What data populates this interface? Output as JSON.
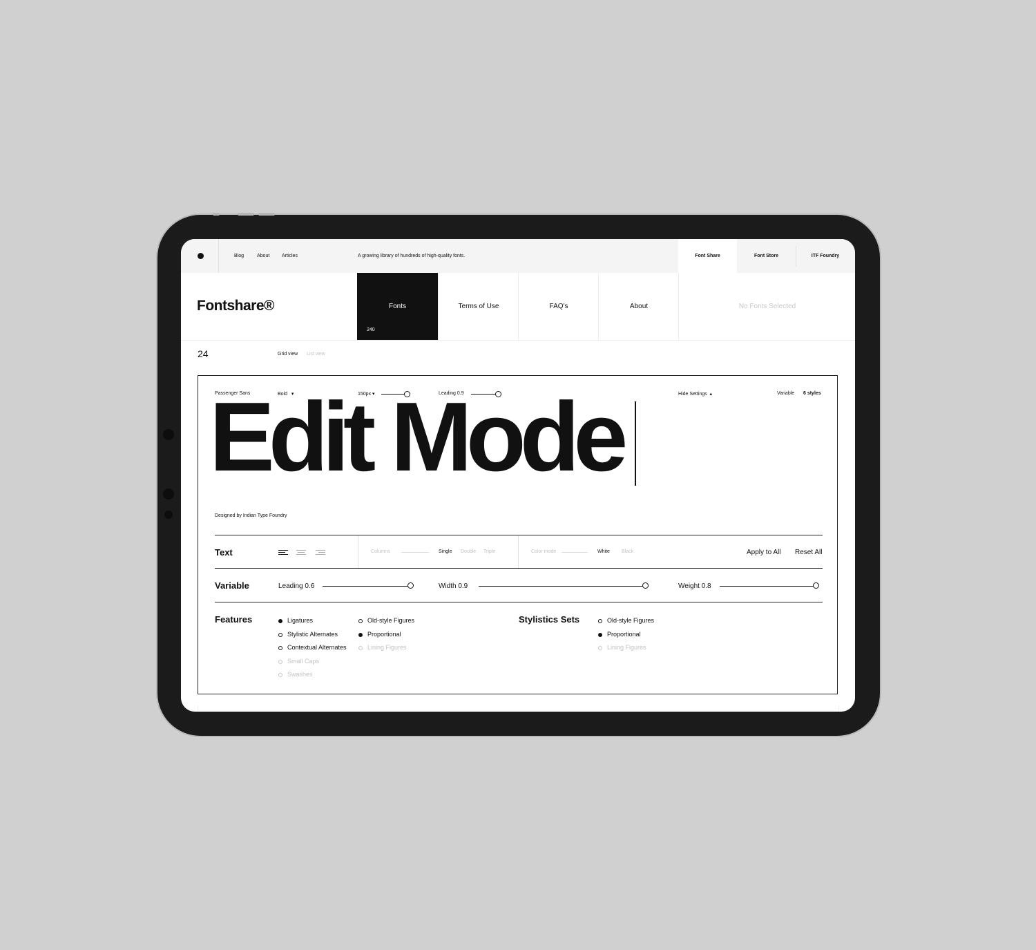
{
  "topbar": {
    "links": [
      "Blog",
      "About",
      "Articles"
    ],
    "tagline": "A growing library of hundreds of high-quality fonts.",
    "tabs": [
      "Font Share",
      "Font Store",
      "ITF Foundry"
    ]
  },
  "header": {
    "logo": "Fontshare®",
    "nav": [
      {
        "label": "Fonts",
        "count": "240"
      },
      {
        "label": "Terms of Use"
      },
      {
        "label": "FAQ's"
      },
      {
        "label": "About"
      }
    ],
    "selection": "No Fonts Selected"
  },
  "listbar": {
    "count": "24",
    "views": [
      "Grid view",
      "List view"
    ]
  },
  "card": {
    "font_name": "Passenger Sans",
    "weight": "Bold",
    "size": "150px",
    "leading_label": "Leading 0.9",
    "hide_settings": "Hide Settings",
    "variable": "Variable",
    "styles": "6 styles",
    "preview_text": "Edit Mode",
    "designer": "Designed by Indian Type Foundry"
  },
  "text_row": {
    "label": "Text",
    "columns_label": "Columns",
    "columns": [
      "Single",
      "Double",
      "Triple"
    ],
    "colormode_label": "Color mode",
    "colormodes": [
      "White",
      "Black"
    ],
    "apply_all": "Apply to All",
    "reset_all": "Reset All"
  },
  "variable_row": {
    "label": "Variable",
    "leading": "Leading 0.6",
    "width": "Width 0.9",
    "weight": "Weight 0.8",
    "leading_level": 0.98,
    "width_level": 0.98,
    "weight_level": 0.98
  },
  "features": {
    "label": "Features",
    "col1": [
      "Ligatures",
      "Stylistic Alternates",
      "Contextual Alternates",
      "Small Caps",
      "Swashes"
    ],
    "col2": [
      "Old-style Figures",
      "Proportional",
      "Lining Figures"
    ],
    "sets_label": "Stylistics Sets",
    "sets": [
      "Old-style Figures",
      "Proportional",
      "Lining Figures"
    ]
  },
  "colors": {
    "background": "#d0d0d0",
    "device": "#1b1b1b",
    "ink": "#111111",
    "active_nav": "#111111",
    "dim": "#c2c2c2"
  }
}
